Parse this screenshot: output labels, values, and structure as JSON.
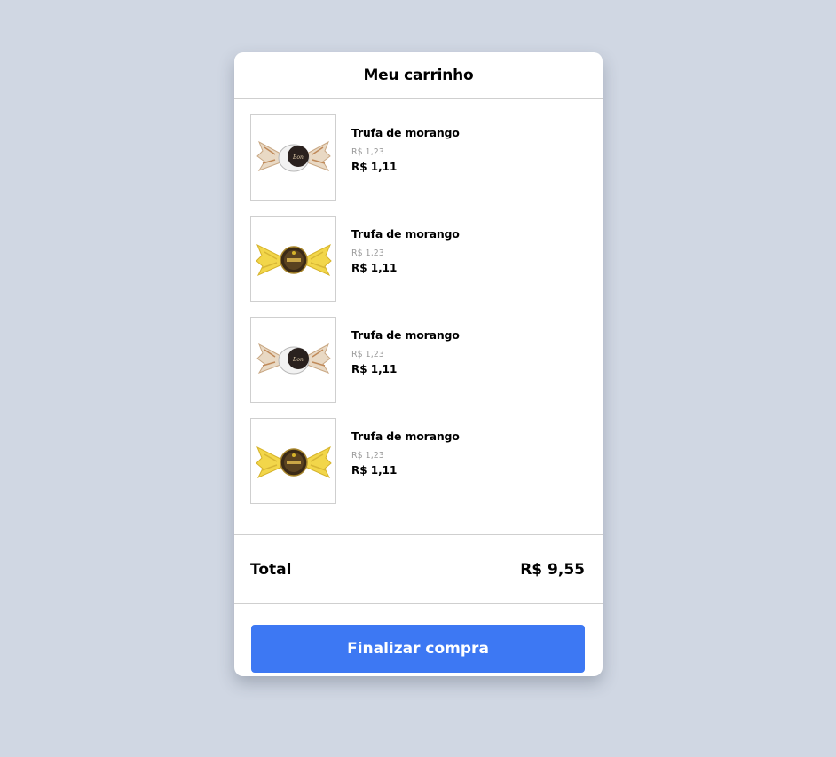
{
  "cart": {
    "title": "Meu carrinho",
    "items": [
      {
        "name": "Trufa de morango",
        "old_price": "R$ 1,23",
        "price": "R$ 1,11",
        "image": "truffle-candy-white-wrapper"
      },
      {
        "name": "Trufa de morango",
        "old_price": "R$ 1,23",
        "price": "R$ 1,11",
        "image": "truffle-candy-yellow-wrapper"
      },
      {
        "name": "Trufa de morango",
        "old_price": "R$ 1,23",
        "price": "R$ 1,11",
        "image": "truffle-candy-white-wrapper"
      },
      {
        "name": "Trufa de morango",
        "old_price": "R$ 1,23",
        "price": "R$ 1,11",
        "image": "truffle-candy-yellow-wrapper"
      }
    ],
    "total_label": "Total",
    "total_value": "R$ 9,55",
    "checkout_label": "Finalizar compra"
  },
  "colors": {
    "background": "#d0d7e3",
    "card": "#ffffff",
    "button": "#3d78f3",
    "divider": "#cfcfcf",
    "old_price": "#9a9a9a"
  }
}
